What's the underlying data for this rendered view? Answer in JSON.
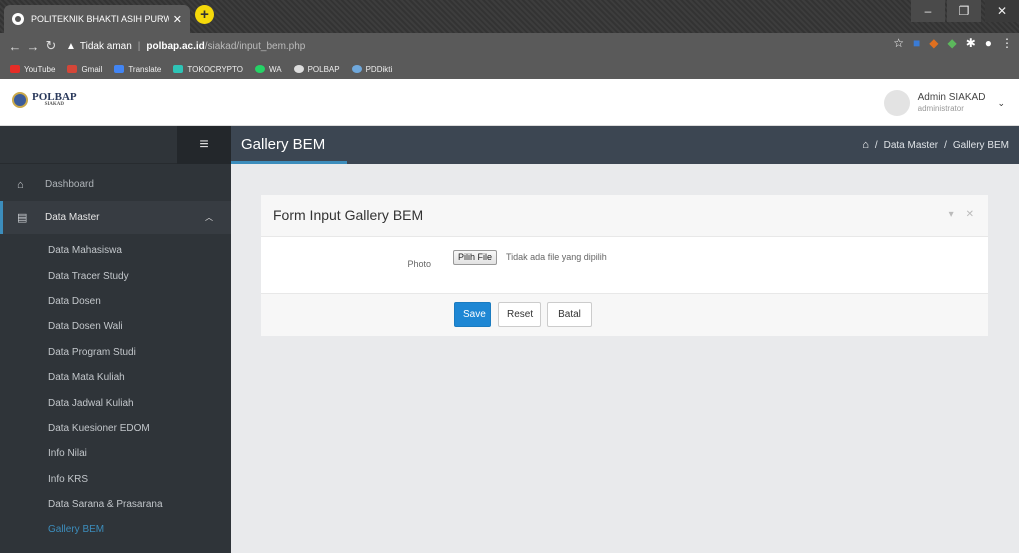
{
  "browser": {
    "tab_title": "POLITEKNIK BHAKTI ASIH PURWA",
    "new_tab": "+",
    "security": "Tidak aman",
    "url_host": "polbap.ac.id",
    "url_path": "/siakad/input_bem.php",
    "bookmarks": [
      "YouTube",
      "Gmail",
      "Translate",
      "TOKOCRYPTO",
      "WA",
      "POLBAP",
      "PDDikti"
    ]
  },
  "header": {
    "logo_text": "POLBAP",
    "logo_sub": "SIAKAD",
    "user_name": "Admin SIAKAD",
    "user_role": "administrator"
  },
  "sidebar": {
    "dashboard": "Dashboard",
    "data_master": "Data Master",
    "items": [
      "Data Mahasiswa",
      "Data Tracer Study",
      "Data Dosen",
      "Data Dosen Wali",
      "Data Program Studi",
      "Data Mata Kuliah",
      "Data Jadwal Kuliah",
      "Data Kuesioner EDOM",
      "Info Nilai",
      "Info KRS",
      "Data Sarana & Prasarana",
      "Gallery BEM"
    ],
    "active_item": "Gallery BEM"
  },
  "content": {
    "page_title": "Gallery BEM",
    "breadcrumb": [
      "Data Master",
      "Gallery BEM"
    ],
    "breadcrumb_sep": "/"
  },
  "form": {
    "title": "Form Input Gallery BEM",
    "photo_label": "Photo",
    "file_button": "Pilih File",
    "file_status": "Tidak ada file yang dipilih",
    "save": "Save",
    "reset": "Reset",
    "cancel": "Batal"
  },
  "colors": {
    "accent": "#3c8dbc",
    "sidebar_bg": "#2f3439",
    "content_header_bg": "#3c4652",
    "save_button": "#1e87d4"
  }
}
